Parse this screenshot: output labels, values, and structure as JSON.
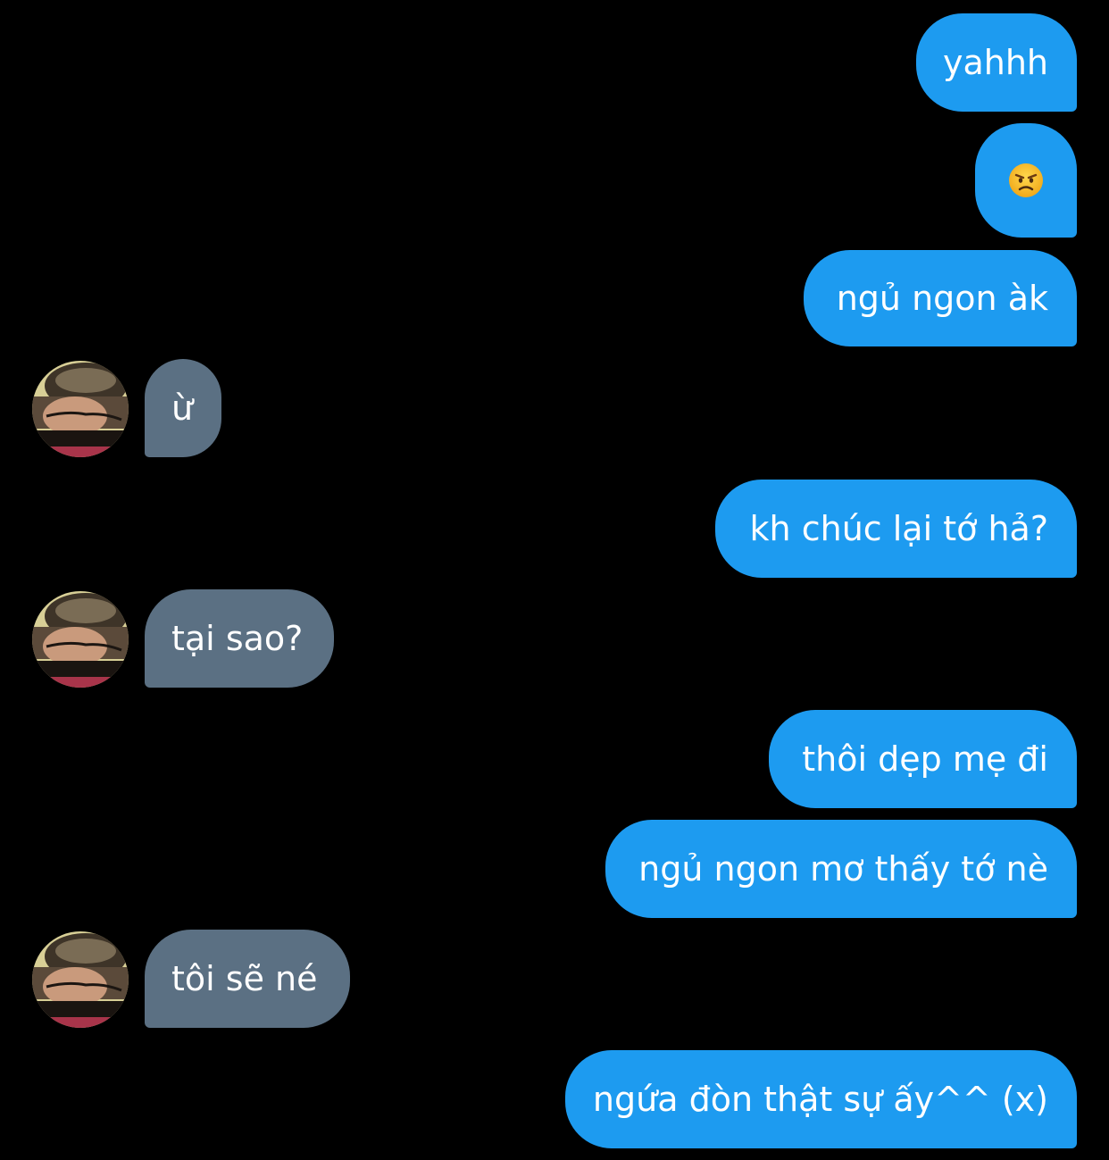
{
  "conversation": {
    "messages": [
      {
        "side": "out",
        "text": "yahhh"
      },
      {
        "side": "out",
        "text": "",
        "emoji": "angry-face-icon"
      },
      {
        "side": "out",
        "text": "ngủ ngon àk"
      },
      {
        "side": "in",
        "text": "ừ"
      },
      {
        "side": "out",
        "text": "kh chúc lại tớ hả?"
      },
      {
        "side": "in",
        "text": "tại sao?"
      },
      {
        "side": "out",
        "text": "thôi dẹp mẹ đi"
      },
      {
        "side": "out",
        "text": "ngủ ngon mơ thấy tớ nè"
      },
      {
        "side": "in",
        "text": "tôi sẽ né"
      },
      {
        "side": "out",
        "text": "ngứa đòn thật sự ấy^^ (x)"
      }
    ]
  },
  "colors": {
    "background": "#000000",
    "outgoing_bubble": "#1d9bf0",
    "incoming_bubble": "#5b7083",
    "text": "#ffffff"
  }
}
